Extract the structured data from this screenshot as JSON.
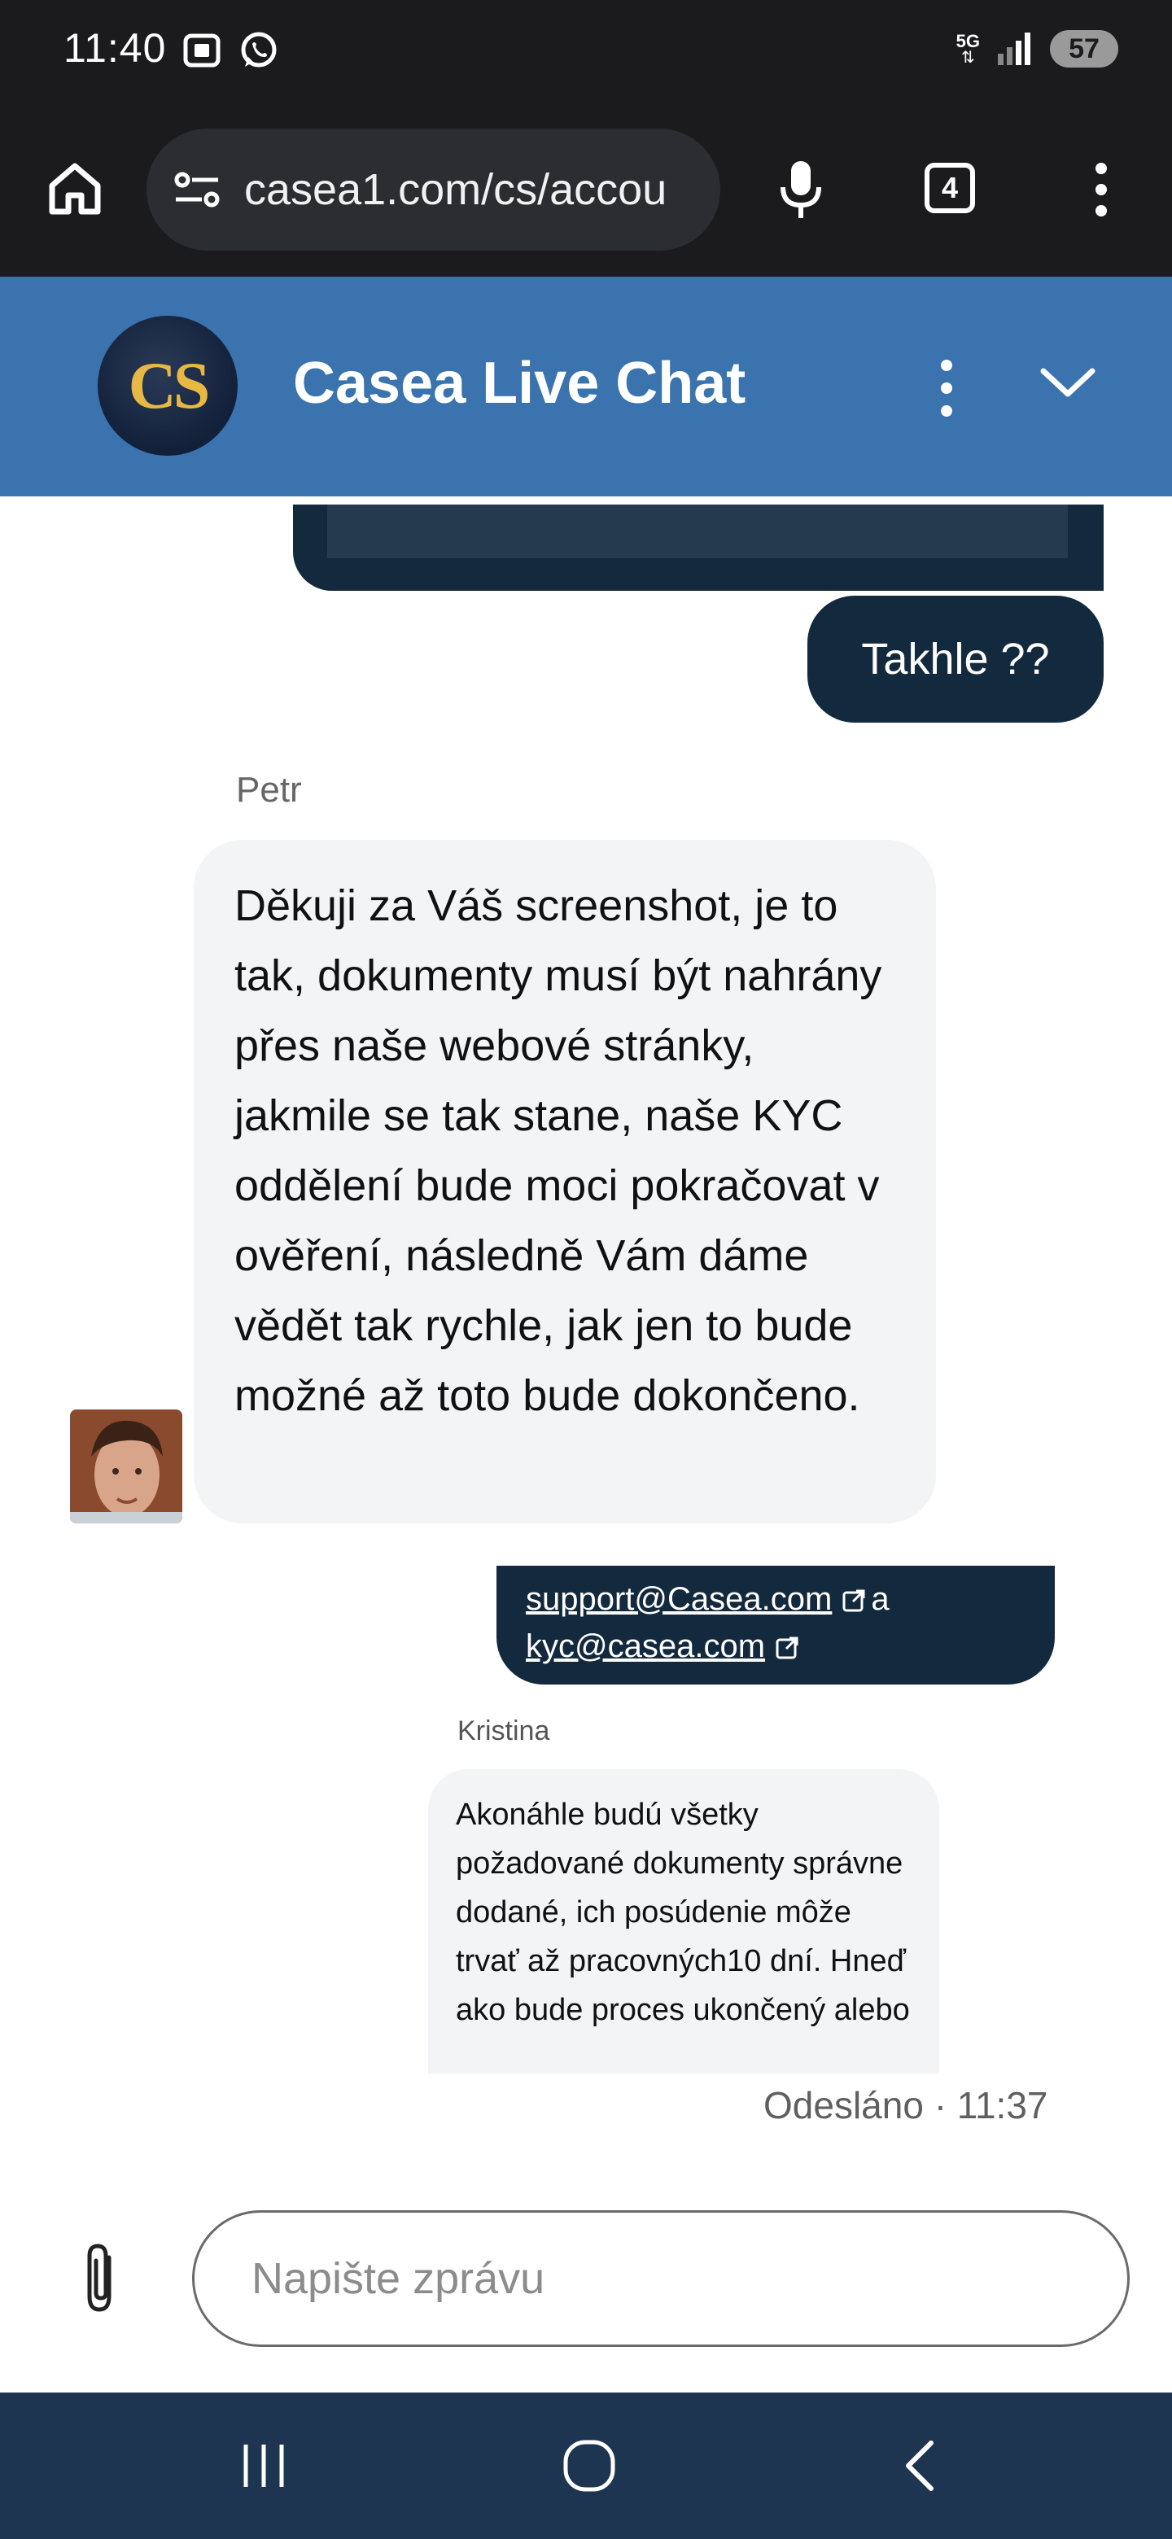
{
  "status_bar": {
    "time": "11:40",
    "network": "5G",
    "battery": "57"
  },
  "browser": {
    "url": "casea1.com/cs/accou",
    "tab_count": "4"
  },
  "chat": {
    "title": "Casea Live Chat",
    "logo_text": "CS",
    "messages": [
      {
        "text": "Takhle ??"
      },
      {
        "sender": "Petr",
        "text": "Děkuji za Váš screenshot, je to tak, dokumenty musí být nahrány přes naše webové stránky, jakmile se tak stane, naše KYC oddělení bude moci pokračovat v ověření, následně Vám dáme vědět tak rychle, jak jen to bude možné až toto bude dokončeno."
      },
      {
        "link1": "support@Casea.com",
        "conjunction": "a",
        "link2": "kyc@casea.com"
      },
      {
        "sender": "Kristina",
        "text": "Akonáhle budú všetky požadované dokumenty správne dodané, ich posúdenie môže trvať až pracovných10 dní. Hneď ako bude proces ukončený alebo"
      }
    ],
    "sent_status": "Odesláno · 11:37"
  },
  "input": {
    "placeholder": "Napište zprávu"
  },
  "colors": {
    "header": "#3a73ae",
    "user_bubble": "#13293d",
    "agent_bubble": "#f3f4f6",
    "navbar": "#1d3550"
  }
}
